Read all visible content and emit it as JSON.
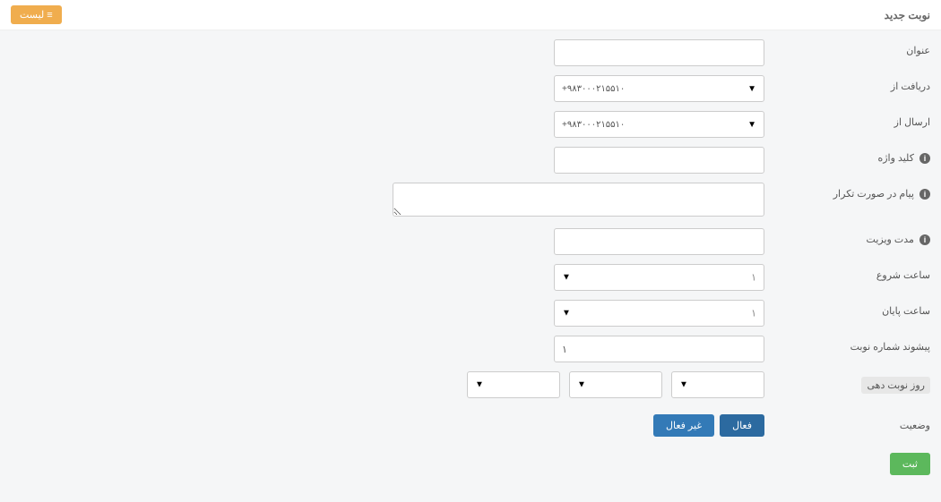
{
  "header": {
    "title": "نوبت جدید",
    "list_btn": "لیست"
  },
  "labels": {
    "title": "عنوان",
    "receive_from": "دریافت از",
    "send_from": "ارسال از",
    "keyword": "کلید واژه",
    "repeat_msg": "پیام در صورت تکرار",
    "visit_duration": "مدت ویزیت",
    "start_hour": "ساعت شروع",
    "end_hour": "ساعت پایان",
    "prefix": "پیشوند شماره نوبت",
    "appointment_day": "روز نوبت دهی",
    "status": "وضعیت"
  },
  "fields": {
    "receive_from_value": "+۹۸۳۰۰۰۲۱۵۵۱۰",
    "send_from_value": "+۹۸۳۰۰۰۲۱۵۵۱۰",
    "start_hour_value": "۱",
    "end_hour_value": "۱",
    "prefix_value": "۱"
  },
  "buttons": {
    "active": "فعال",
    "inactive": "غیر فعال",
    "submit": "ثبت"
  }
}
